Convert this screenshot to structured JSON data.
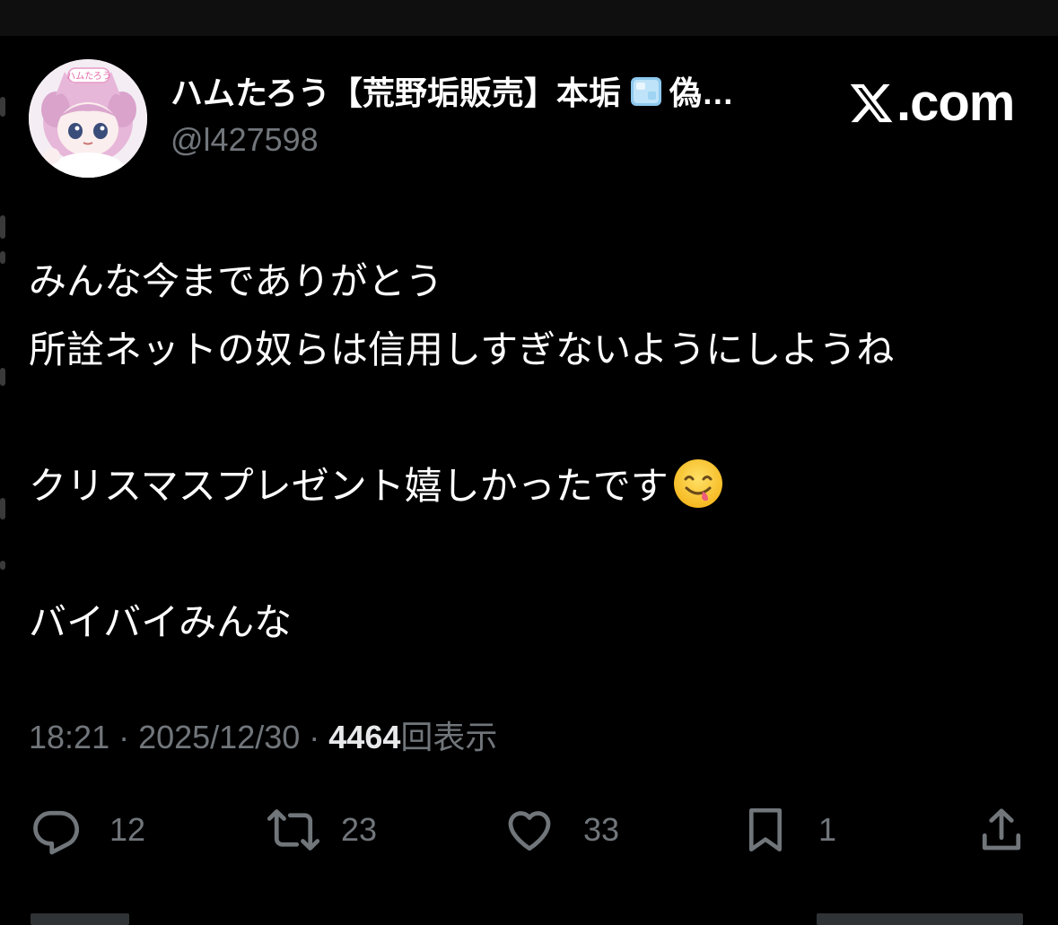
{
  "post": {
    "author": {
      "display_name": "ハムたろう【荒野垢販売】本垢",
      "display_name_suffix": "偽…",
      "handle": "@l427598",
      "avatar_badge_text": "ハムたろう"
    },
    "branding": {
      "site": ".com"
    },
    "text_lines": [
      "みんな今までありがとう",
      "所詮ネットの奴らは信用しすぎないようにしようね",
      "",
      "クリスマスプレゼント嬉しかったです",
      "",
      "バイバイみんな"
    ],
    "emoji": "yum-face",
    "meta": {
      "time": "18:21",
      "separator": " · ",
      "date": "2025/12/30",
      "views_count": "4464",
      "views_label": "回表示"
    },
    "actions": {
      "replies": "12",
      "reposts": "23",
      "likes": "33",
      "bookmarks": "1"
    }
  },
  "colors": {
    "background": "#000000",
    "text_primary": "#ffffff",
    "text_secondary": "#71767b",
    "icon": "#71767b"
  }
}
